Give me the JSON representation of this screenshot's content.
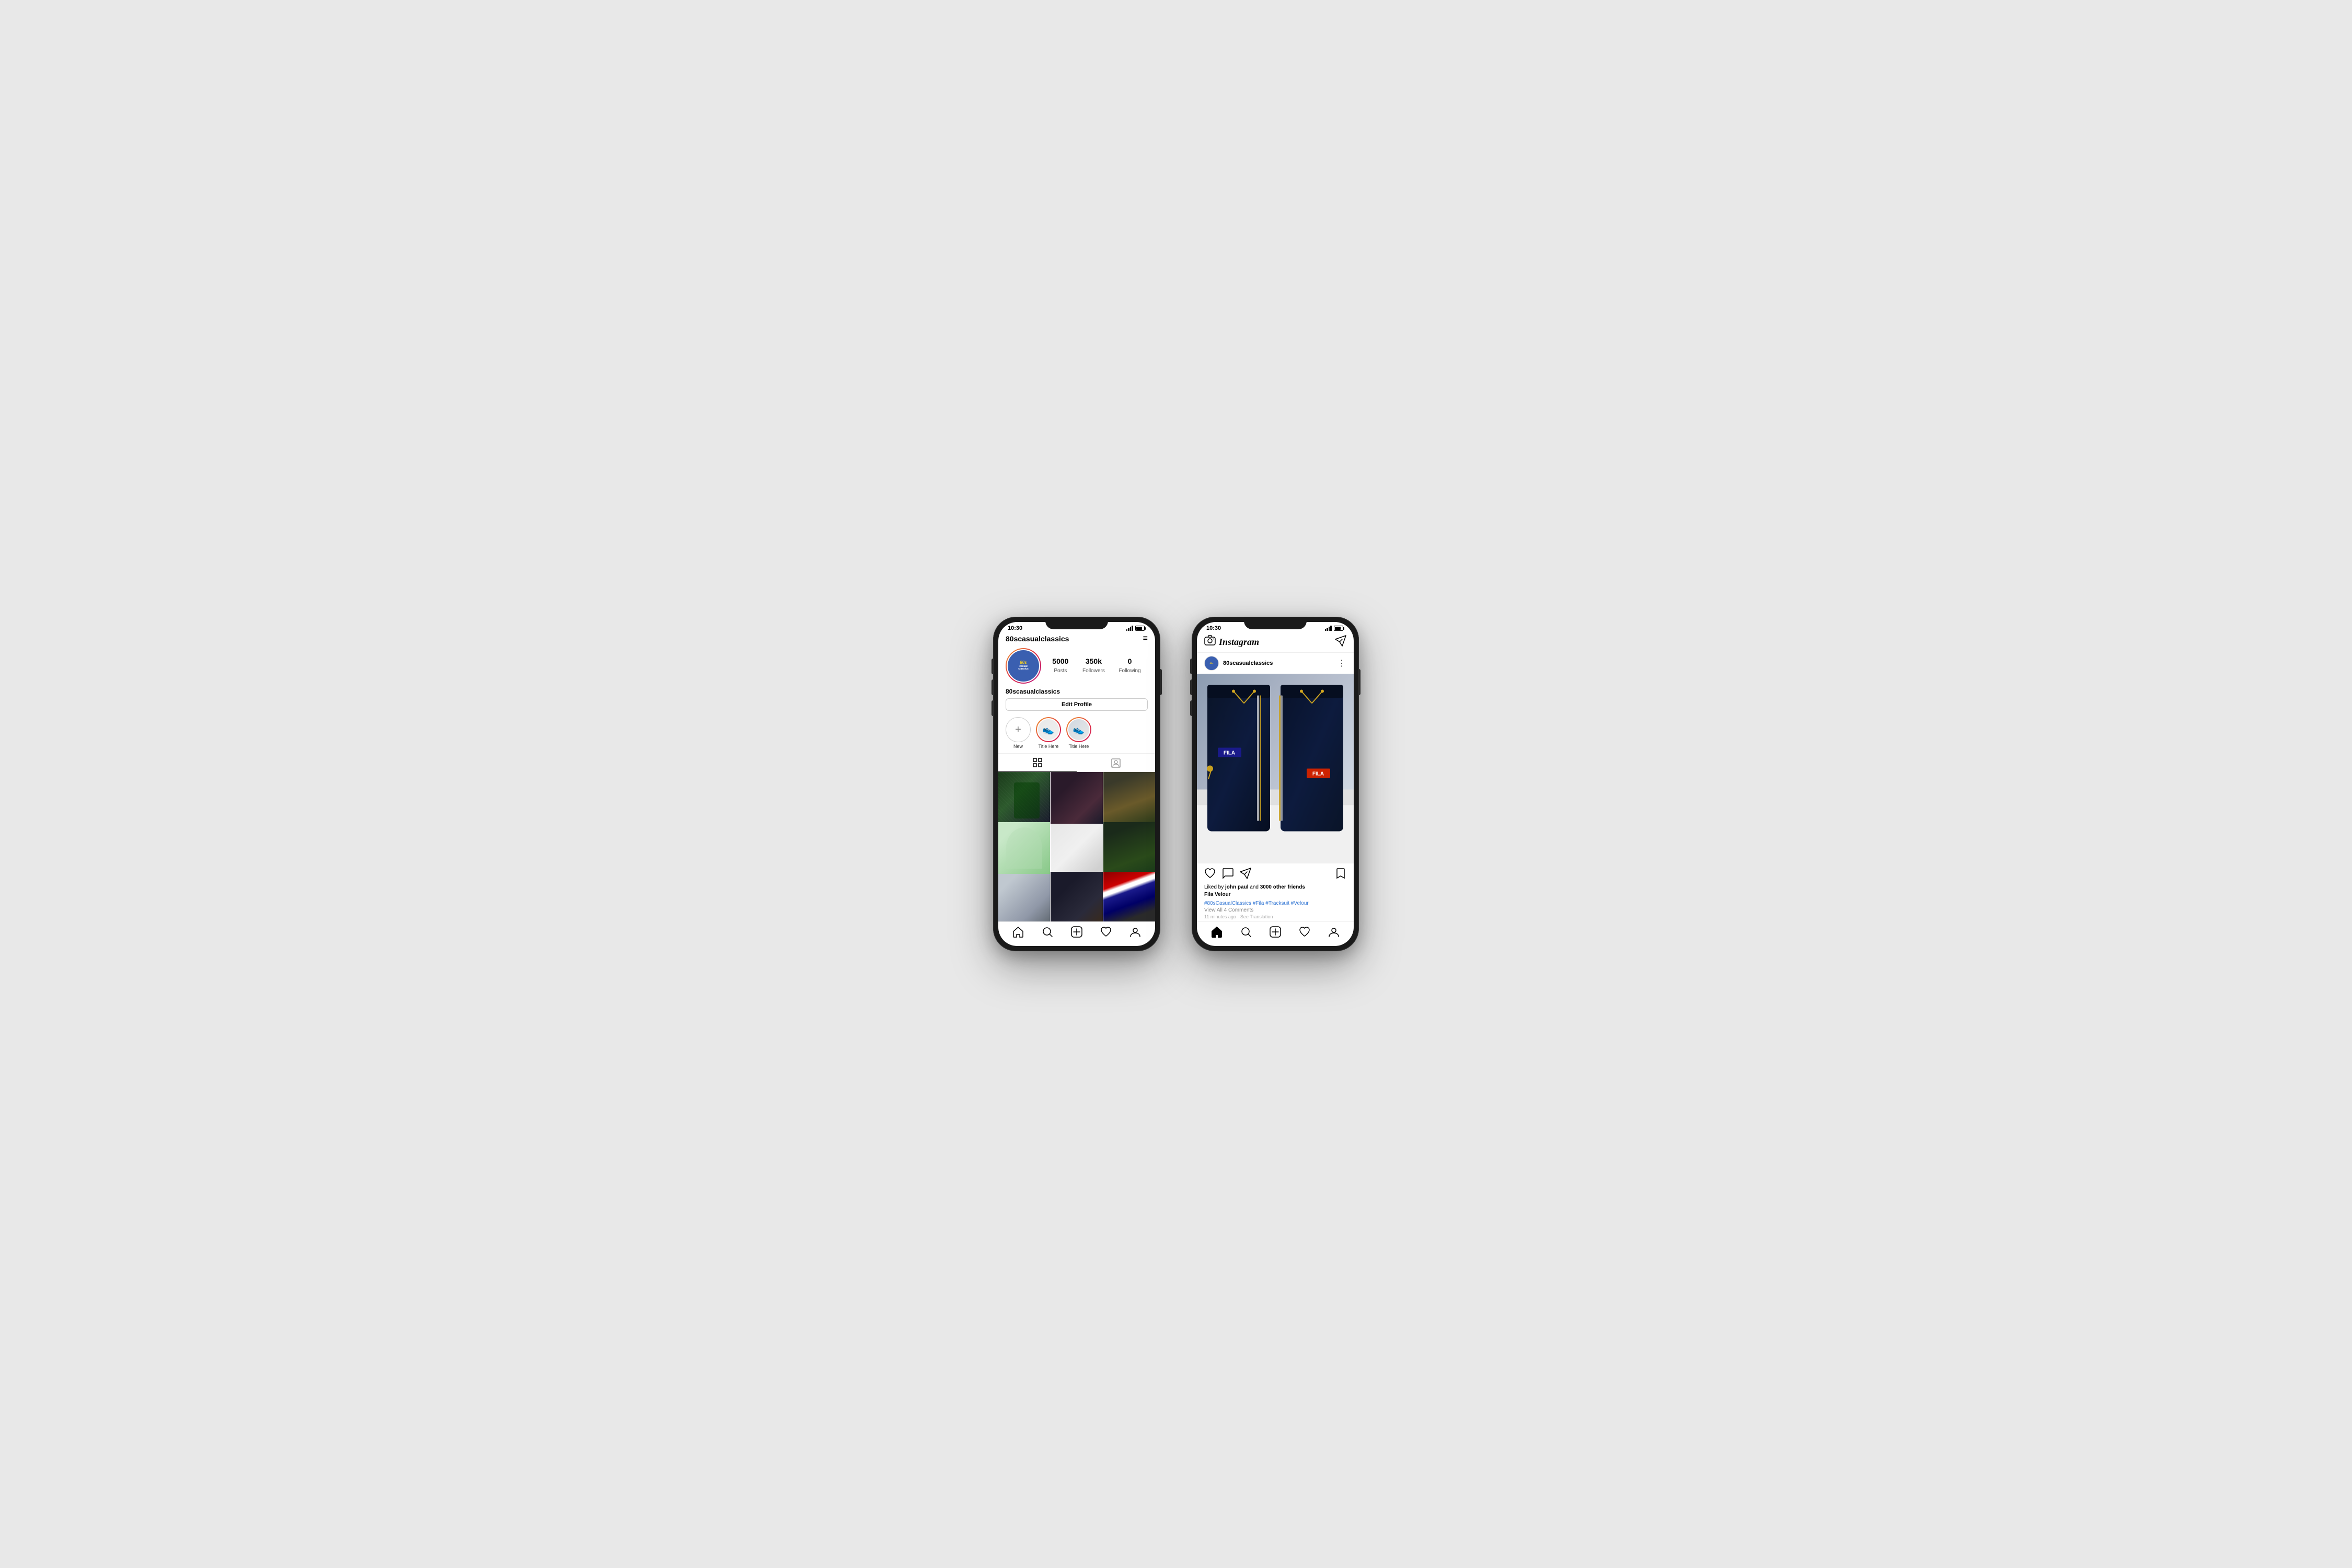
{
  "background": "#e8e8e8",
  "phone1": {
    "statusBar": {
      "time": "10:30"
    },
    "header": {
      "username": "80scasualclassics",
      "menuIcon": "≡"
    },
    "profile": {
      "avatarAlt": "80s Casual Classics logo",
      "stats": [
        {
          "value": "5000",
          "label": "Posts"
        },
        {
          "value": "350k",
          "label": "Followers"
        },
        {
          "value": "0",
          "label": "Following"
        }
      ],
      "displayName": "80scasualclassics",
      "editButton": "Edit Profile"
    },
    "stories": [
      {
        "type": "add",
        "label": "New"
      },
      {
        "type": "story",
        "label": "Title Here"
      },
      {
        "type": "story",
        "label": "Title Here"
      }
    ],
    "tabs": [
      {
        "icon": "grid",
        "active": true
      },
      {
        "icon": "person",
        "active": false
      }
    ],
    "bottomNav": [
      "home",
      "search",
      "add",
      "heart",
      "profile"
    ]
  },
  "phone2": {
    "statusBar": {
      "time": "10:30"
    },
    "header": {
      "cameraIcon": "📷",
      "title": "Instagram",
      "sendIcon": "➤"
    },
    "post": {
      "username": "80scasualclassics",
      "moreIcon": "⋮",
      "imageAlt": "Fila Velour Tracksuit Navy",
      "caption": {
        "likedBy": "john paul",
        "likedCount": "3000 other friends",
        "productName": "Fila Velour",
        "hashtags": "#80sCasualClassics #Fila #Tracksuit #Velour",
        "viewComments": "View All 4 Comments",
        "timestamp": "11 minutes ago",
        "seeTranslation": "See Translation"
      },
      "actions": {
        "like": "♡",
        "comment": "○",
        "share": "➤",
        "save": "🔖"
      }
    },
    "bottomNav": [
      "home",
      "search",
      "add",
      "heart",
      "profile"
    ]
  }
}
